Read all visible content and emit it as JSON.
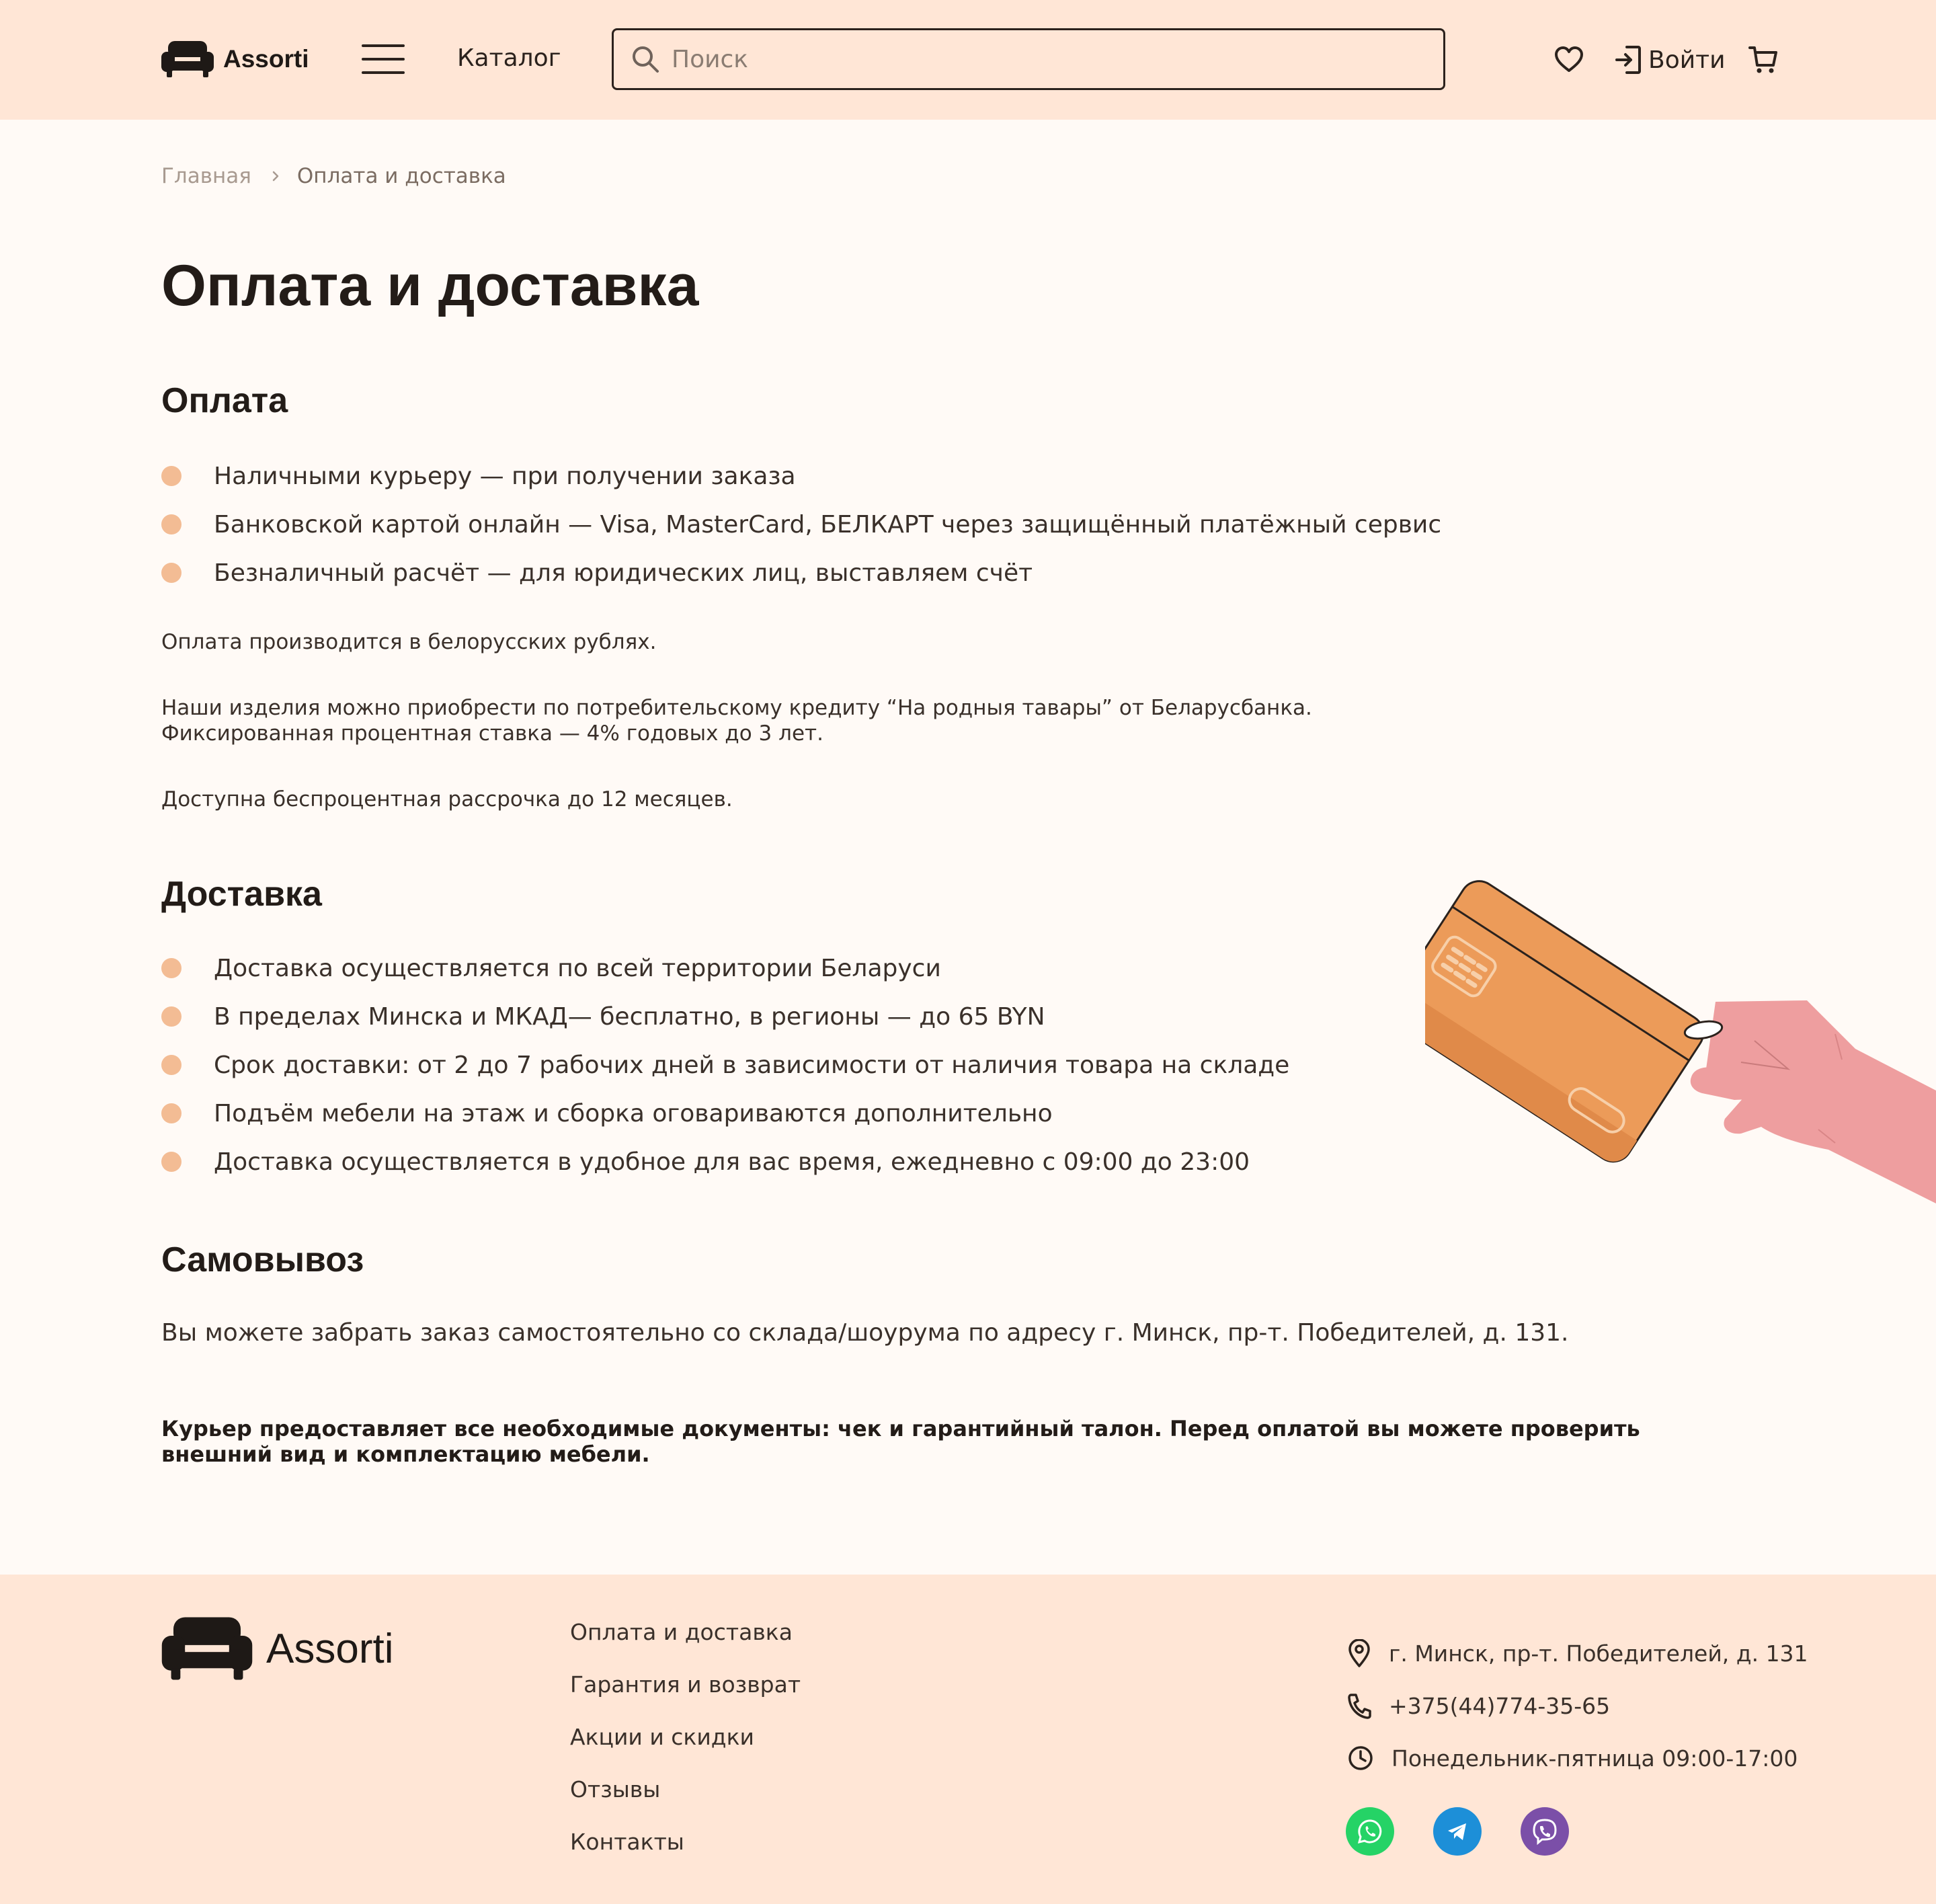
{
  "header": {
    "logo_text": "Assorti",
    "catalog_label": "Каталог",
    "search_placeholder": "Поиск",
    "login_label": "Войти"
  },
  "breadcrumb": {
    "home": "Главная",
    "current": "Оплата и доставка"
  },
  "page_title": "Оплата и доставка",
  "payment": {
    "title": "Оплата",
    "items": [
      "Наличными курьеру — при получении заказа",
      "Банковской картой онлайн — Visa, MasterCard, БЕЛКАРТ через защищённый платёжный сервис",
      "Безналичный расчёт — для юридических лиц, выставляем счёт"
    ],
    "note_currency": "Оплата производится в белорусских рублях.",
    "note_credit_line1": "Наши изделия можно приобрести по потребительскому кредиту “На родныя тавары” от Беларусбанка.",
    "note_credit_line2": "Фиксированная процентная ставка — 4% годовых до 3 лет.",
    "note_installment": "Доступна беспроцентная рассрочка до 12 месяцев."
  },
  "delivery": {
    "title": "Доставка",
    "items": [
      "Доставка осуществляется по всей территории Беларуси",
      "В пределах Минска и МКАД— бесплатно, в регионы — до 65 BYN",
      "Срок доставки: от 2 до 7 рабочих дней в зависимости от наличия товара на складе",
      "Подъём мебели на этаж и сборка оговариваются дополнительно",
      "Доставка осуществляется в удобное для вас время, ежедневно с 09:00 до 23:00"
    ]
  },
  "pickup": {
    "title": "Самовывоз",
    "text": "Вы можете забрать заказ самостоятельно со склада/шоурума по адресу г. Минск, пр-т. Победителей, д. 131."
  },
  "courier_note": "Курьер предоставляет все необходимые документы: чек и гарантийный талон. Перед оплатой вы можете проверить внешний вид и комплектацию мебели.",
  "footer": {
    "logo_text": "Assorti",
    "links": [
      "Оплата и доставка",
      "Гарантия и возврат",
      "Акции и скидки",
      "Отзывы",
      "Контакты"
    ],
    "address": "г. Минск, пр-т. Победителей, д. 131",
    "phone": "+375(44)774-35-65",
    "hours": "Понедельник-пятница 09:00-17:00"
  },
  "colors": {
    "header_bg": "#ffe6d6",
    "page_bg": "#fffaf6",
    "bullet": "#f3bc94",
    "card": "#ec9b59",
    "hand": "#ee9e9f",
    "whatsapp": "#25d366",
    "telegram": "#1d8fd8",
    "viber": "#7b4fa8"
  },
  "icons": [
    "sofa-logo-icon",
    "burger-menu-icon",
    "search-icon",
    "heart-icon",
    "login-icon",
    "cart-icon",
    "chevron-right-icon",
    "location-pin-icon",
    "phone-icon",
    "clock-icon",
    "whatsapp-icon",
    "telegram-icon",
    "viber-icon"
  ]
}
